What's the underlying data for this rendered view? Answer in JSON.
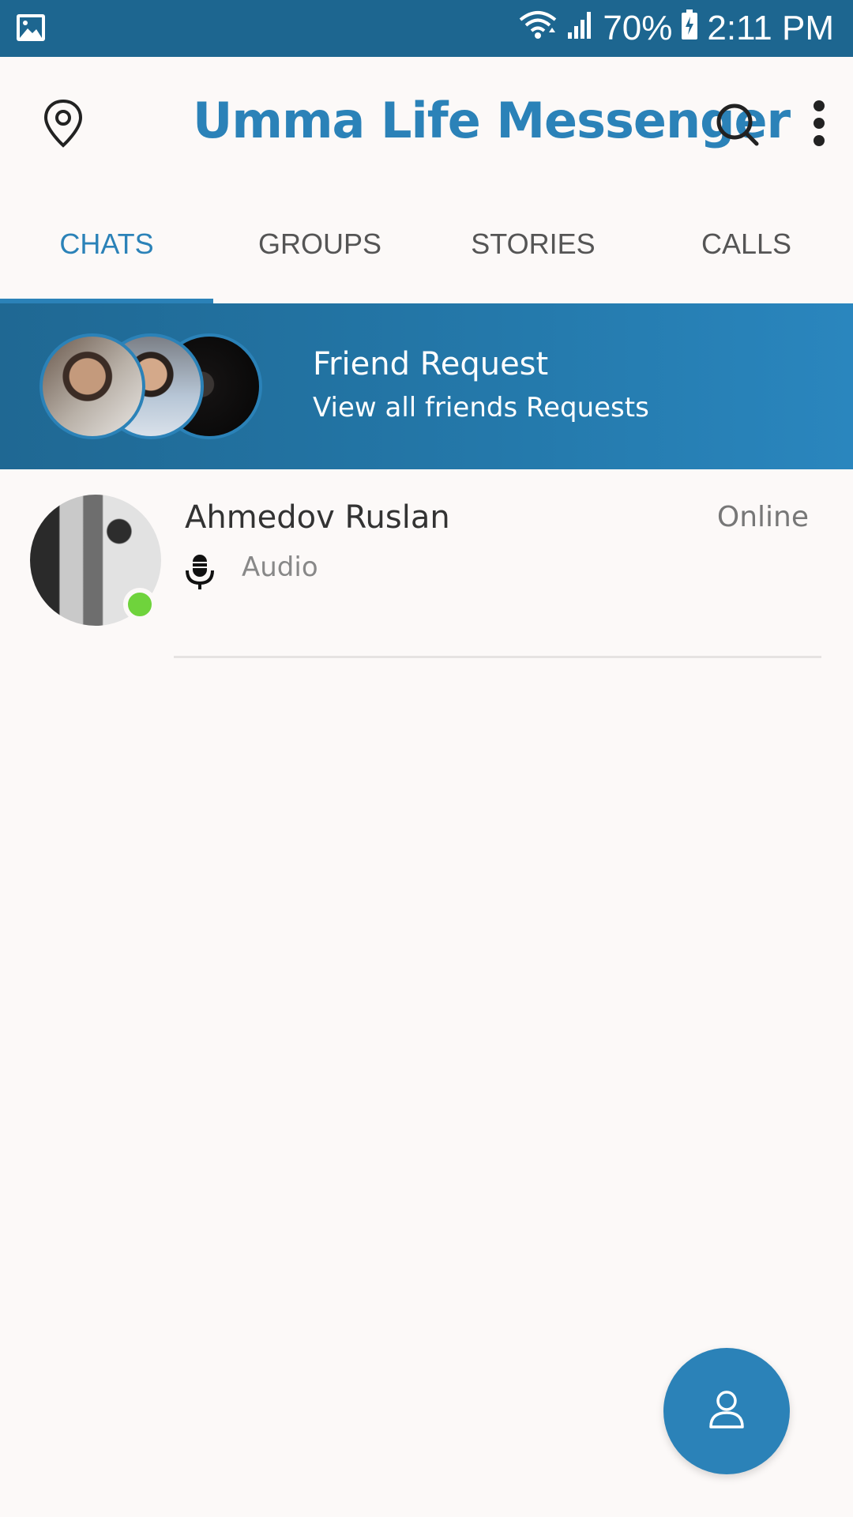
{
  "status_bar": {
    "battery": "70%",
    "time": "2:11 PM",
    "icons": [
      "gallery-icon",
      "wifi-icon",
      "signal-icon",
      "battery-charging-icon"
    ]
  },
  "app_bar": {
    "title": "Umma Life Messenger",
    "icons": [
      "location-pin-icon",
      "search-icon",
      "more-vert-icon"
    ]
  },
  "tabs": [
    {
      "label": "CHATS",
      "active": true
    },
    {
      "label": "GROUPS",
      "active": false
    },
    {
      "label": "STORIES",
      "active": false
    },
    {
      "label": "CALLS",
      "active": false
    }
  ],
  "friend_request": {
    "title": "Friend Request",
    "subtitle": "View all friends Requests"
  },
  "chats": [
    {
      "name": "Ahmedov Ruslan",
      "status": "Online",
      "last_message": "Audio",
      "message_icon": "microphone-icon",
      "online": true
    }
  ],
  "fab": {
    "icon": "person-icon"
  },
  "colors": {
    "status_bar": "#1d6690",
    "accent": "#2b82b8",
    "background": "#fcf9f8",
    "online": "#6fd33c"
  }
}
